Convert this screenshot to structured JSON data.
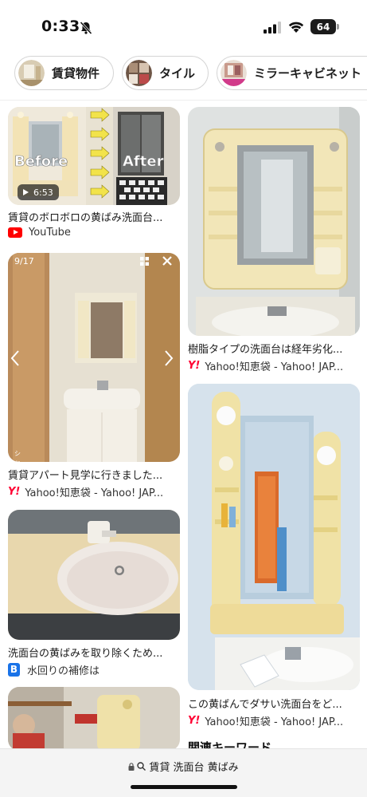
{
  "status": {
    "time": "0:33",
    "battery": "64"
  },
  "chips": [
    {
      "label": "賃貸物件",
      "thumb_color": "#cfc2a8"
    },
    {
      "label": "タイル",
      "thumb_color": "#8a6e5b"
    },
    {
      "label": "ミラーキャビネット",
      "thumb_color": "#b58a76"
    }
  ],
  "cards": [
    {
      "title": "賃貸のボロボロの黄ばみ洗面台...",
      "source": "YouTube",
      "video_duration": "6:53",
      "overlay_before": "Before",
      "overlay_after": "After"
    },
    {
      "title": "樹脂タイプの洗面台は経年劣化...",
      "source": "Yahoo!知恵袋 - Yahoo! JAP..."
    },
    {
      "title": "賃貸アパート見学に行きました...",
      "source": "Yahoo!知恵袋 - Yahoo! JAP...",
      "page_counter": "9/17",
      "image_caption": "シャワー付き洗面化粧台"
    },
    {
      "title": "この黄ばんでダサい洗面台をど...",
      "source": "Yahoo!知恵袋 - Yahoo! JAP..."
    },
    {
      "title": "洗面台の黄ばみを取り除くため...",
      "source": "水回りの補修は"
    }
  ],
  "source_marks": {
    "yahoo": "Y!",
    "blog": "B"
  },
  "related": {
    "heading": "関連キーワード"
  },
  "address_bar": {
    "query": "賃貸 洗面台 黄ばみ"
  }
}
